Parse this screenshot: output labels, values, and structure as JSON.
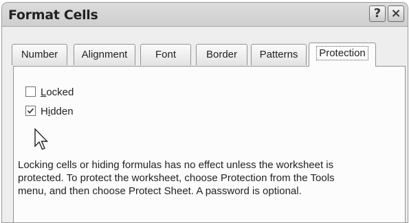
{
  "window": {
    "title": "Format Cells",
    "help_icon": "question-mark-icon",
    "close_icon": "close-icon",
    "help_glyph": "?",
    "close_glyph": "×"
  },
  "tabs": [
    {
      "label": "Number",
      "active": false
    },
    {
      "label": "Alignment",
      "active": false
    },
    {
      "label": "Font",
      "active": false
    },
    {
      "label": "Border",
      "active": false
    },
    {
      "label": "Patterns",
      "active": false
    },
    {
      "label": "Protection",
      "active": true
    }
  ],
  "protection": {
    "locked": {
      "label_pre": "",
      "label_mnemonic": "L",
      "label_post": "ocked",
      "checked": false
    },
    "hidden": {
      "label_pre": "H",
      "label_mnemonic": "i",
      "label_post": "dden",
      "checked": true
    },
    "note": "Locking cells or hiding formulas has no effect unless the worksheet is protected. To protect the worksheet, choose Protection from the Tools menu, and then choose Protect Sheet. A password is optional."
  },
  "cursor_icon": "arrow-cursor-icon",
  "colors": {
    "title_bar": "#d6d6d6",
    "dialog_bg": "#eeeeee",
    "panel_bg": "#fcfcfc",
    "border": "#919191",
    "text": "#222222"
  }
}
